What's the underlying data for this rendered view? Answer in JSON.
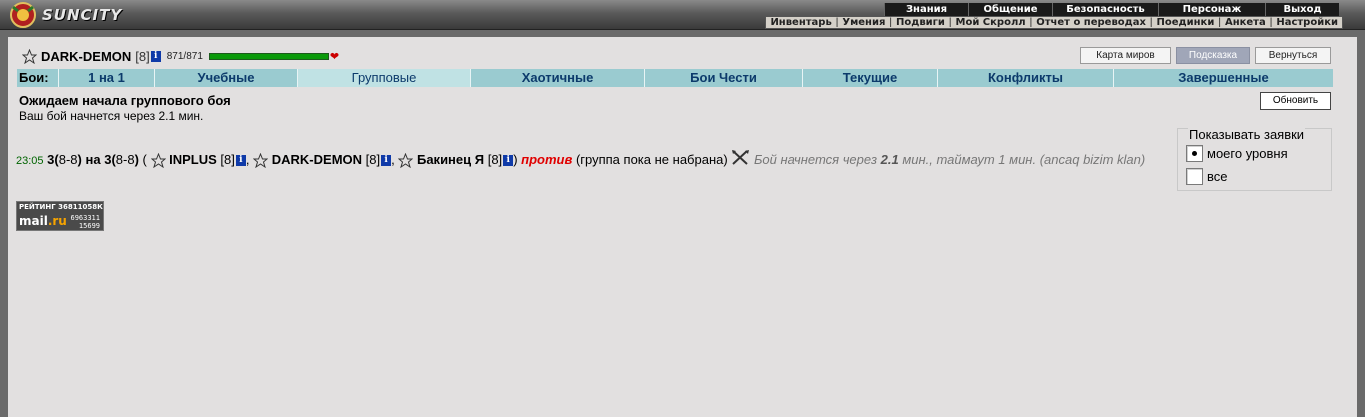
{
  "app": {
    "logo_text": "SUNCITY"
  },
  "menu": {
    "top": [
      "Знания",
      "Общение",
      "Безопасность",
      "Персонаж",
      "Выход"
    ],
    "bottom": [
      "Инвентарь",
      "Умения",
      "Подвиги",
      "Мой Скролл",
      "Отчет о переводах",
      "Поединки",
      "Анкета",
      "Настройки"
    ]
  },
  "user": {
    "nick": "DARK-DEMON",
    "level": "[8]",
    "hp": "871/871",
    "hp_fraction": 1.0
  },
  "buttons": {
    "map": "Карта миров",
    "hint": "Подсказка",
    "back": "Вернуться",
    "refresh": "Обновить"
  },
  "tabs": {
    "label": "Бои:",
    "items": [
      "1 на 1",
      "Учебные",
      "Групповые",
      "Хаотичные",
      "Бои Чести",
      "Текущие",
      "Конфликты",
      "Завершенные"
    ],
    "active": "Групповые"
  },
  "status": {
    "title": "Ожидаем начала группового боя",
    "subtitle": "Ваш бой начнется через 2.1 мин."
  },
  "filter": {
    "title": "Показывать заявки",
    "options": [
      "моего уровня",
      "все"
    ],
    "selected": "моего уровня"
  },
  "battle": {
    "time": "23:05",
    "team_a": "3",
    "range_a": "8-8",
    "on": "на",
    "team_b": "3",
    "range_b": "8-8",
    "players": [
      {
        "nick": "INPLUS",
        "level": "[8]"
      },
      {
        "nick": "DARK-DEMON",
        "level": "[8]"
      },
      {
        "nick": "Бакинец Я",
        "level": "[8]"
      }
    ],
    "versus": "против",
    "opponent_note": "(группа пока не набрана)",
    "starts_text": "Бой начнется через",
    "starts_value": "2.1",
    "starts_unit": "мин., таймаут",
    "timeout_value": "1",
    "timeout_unit": "мин.",
    "comment": "(ancaq bizim klan)"
  },
  "counter": {
    "label": "РЕЙТИНГ",
    "id": "36811058К",
    "brand_a": "mail",
    "brand_b": ".ru",
    "n1": "6963311",
    "n2": "15699"
  },
  "colors": {
    "tabs_bg": "#9acbd0",
    "tab_text": "#0c3a6b",
    "hp_bar": "#0a9a0a",
    "versus": "#e00000",
    "time": "#006400"
  }
}
